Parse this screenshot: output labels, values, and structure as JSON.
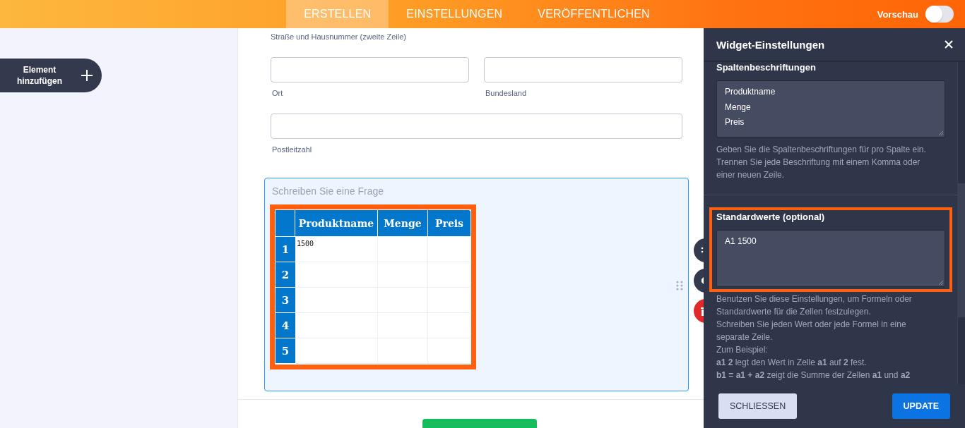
{
  "top_bar": {
    "tabs": [
      {
        "label": "ERSTELLEN",
        "selected": true
      },
      {
        "label": "EINSTELLUNGEN",
        "selected": false
      },
      {
        "label": "VERÖFFENTLICHEN",
        "selected": false
      }
    ],
    "preview": {
      "label": "Vorschau",
      "on": false
    }
  },
  "sidebar": {
    "add_button": {
      "label": "Element hinzufügen"
    }
  },
  "form": {
    "address_line_2_label": "Straße und Hausnummer (zweite Zeile)",
    "field_rows": [
      {
        "fields": [
          {
            "label": "Ort"
          },
          {
            "label": "Bundesland"
          }
        ]
      },
      {
        "fields": [
          {
            "label": "Postleitzahl"
          }
        ]
      }
    ],
    "question": {
      "selected": true,
      "placeholder": "Schreiben Sie eine Frage",
      "table": {
        "highlighted": true,
        "columns": [
          "Produktname",
          "Menge",
          "Preis"
        ],
        "rows": [
          {
            "label": "1",
            "values": [
              "1500"
            ]
          },
          {
            "label": "2"
          },
          {
            "label": "3"
          },
          {
            "label": "4"
          },
          {
            "label": "5"
          }
        ]
      }
    }
  },
  "panel": {
    "title": "Widget-Einstellungen",
    "sections": [
      {
        "heading": "Spaltenbeschriftungen",
        "value": "Produktname\nMenge\nPreis",
        "highlighted": false,
        "help": [
          "Geben Sie die Spaltenbeschriftungen für pro Spalte ein.",
          "Trennen Sie jede Beschriftung mit einem Komma oder einer neuen Zeile."
        ]
      },
      {
        "heading": "Standardwerte (optional)",
        "value": "A1 1500",
        "highlighted": true,
        "help": [
          "Benutzen Sie diese Einstellungen, um Formeln oder Standardwerte für die Zellen festzulegen.",
          "Schreiben Sie jeden Wert oder jede Formel in eine separate Zeile.",
          "Zum Beispiel:",
          "**a1 2** legt den Wert in Zelle **a1** auf **2** fest.",
          "**b1 = a1 + a2** zeigt die Summe der Zellen **a1** und **a2**"
        ]
      }
    ],
    "buttons": [
      {
        "label": "SCHLIESSEN",
        "kind": "secondary"
      },
      {
        "label": "UPDATE",
        "kind": "primary"
      }
    ]
  }
}
